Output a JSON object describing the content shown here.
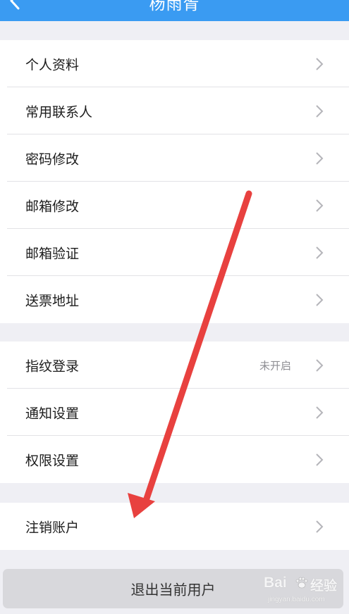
{
  "nav": {
    "title": "杨雨胥"
  },
  "groups": [
    {
      "items": [
        {
          "label": "个人资料"
        },
        {
          "label": "常用联系人"
        },
        {
          "label": "密码修改"
        },
        {
          "label": "邮箱修改"
        },
        {
          "label": "邮箱验证"
        },
        {
          "label": "送票地址"
        }
      ]
    },
    {
      "items": [
        {
          "label": "指纹登录",
          "value": "未开启"
        },
        {
          "label": "通知设置"
        },
        {
          "label": "权限设置"
        }
      ]
    },
    {
      "items": [
        {
          "label": "注销账户"
        }
      ]
    }
  ],
  "logout": {
    "label": "退出当前用户"
  },
  "watermark": {
    "logo_text_a": "Bai",
    "logo_text_b": "经验",
    "url": "jingyan.baidu.com"
  },
  "icons": {
    "back": "chevron-left-icon",
    "row_arrow": "chevron-right-icon",
    "annotation": "red-arrow"
  },
  "colors": {
    "nav_background": "#3a9bf2",
    "page_background": "#efeff4",
    "annotation_arrow": "#e8413f",
    "logout_background": "#d8d8dc"
  }
}
